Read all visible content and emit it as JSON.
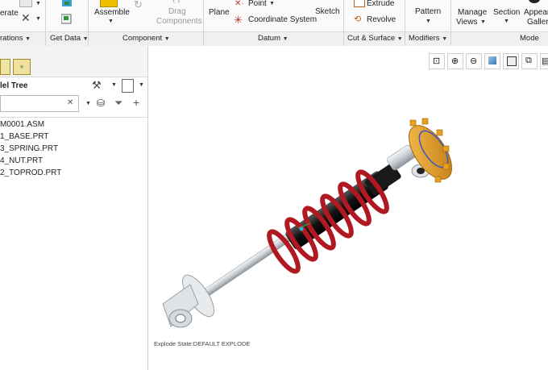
{
  "ribbon": {
    "generate_label": "erate",
    "assemble_label": "Assemble",
    "drag_line1": "Drag",
    "drag_line2": "Components",
    "plane_label": "Plane",
    "point_label": "Point",
    "coord_label": "Coordinate System",
    "sketch_label": "Sketch",
    "extrude_label": "Extrude",
    "revolve_label": "Revolve",
    "pattern_label": "Pattern",
    "manage_line1": "Manage",
    "manage_line2": "Views",
    "section_label": "Section",
    "appear_line1": "Appear",
    "appear_line2": "Gallery"
  },
  "groups": {
    "operations": "rations",
    "get_data": "Get Data",
    "component": "Component",
    "datum": "Datum",
    "cut_surface": "Cut & Surface",
    "modifiers": "Modifiers",
    "model": "Mode"
  },
  "panel": {
    "title": "lel Tree",
    "search_value": "",
    "tree": [
      "M0001.ASM",
      "1_BASE.PRT",
      "3_SPRING.PRT",
      "4_NUT.PRT",
      "2_TOPROD.PRT"
    ]
  },
  "viewport": {
    "status": "Explode State:DEFAULT EXPLODE"
  },
  "colors": {
    "spring": "#b01822",
    "nut": "#e8a020",
    "rod": "#d8dde2",
    "body": "#222222"
  }
}
